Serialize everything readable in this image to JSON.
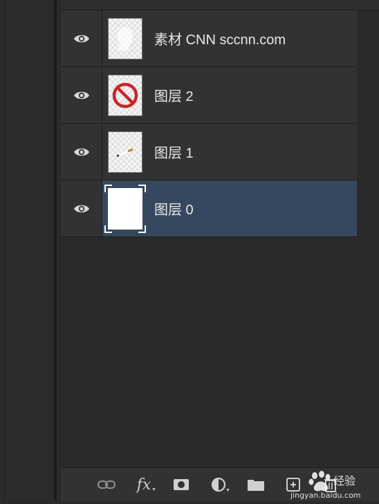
{
  "layers": [
    {
      "name": "素材 CNN sccnn.com",
      "thumb": "transparent-faint",
      "visible": true,
      "selected": false
    },
    {
      "name": "图层 2",
      "thumb": "no-symbol",
      "visible": true,
      "selected": false
    },
    {
      "name": "图层 1",
      "thumb": "cigarette",
      "visible": true,
      "selected": false
    },
    {
      "name": "图层 0",
      "thumb": "white-fill",
      "visible": true,
      "selected": true
    }
  ],
  "toolbar": {
    "fx_label": "fx",
    "tools": [
      "link-icon",
      "fx-icon",
      "mask-icon",
      "adjustment-icon",
      "folder-icon",
      "new-layer-icon",
      "trash-icon"
    ]
  },
  "watermark": {
    "brand": "Baidu 经验",
    "domain": "jingyan.baidu.com"
  },
  "colors": {
    "panel": "#2a2a2a",
    "row": "#323232",
    "selected": "#36485f",
    "text": "#e8e8e8",
    "eye": "#d8d8d8"
  }
}
